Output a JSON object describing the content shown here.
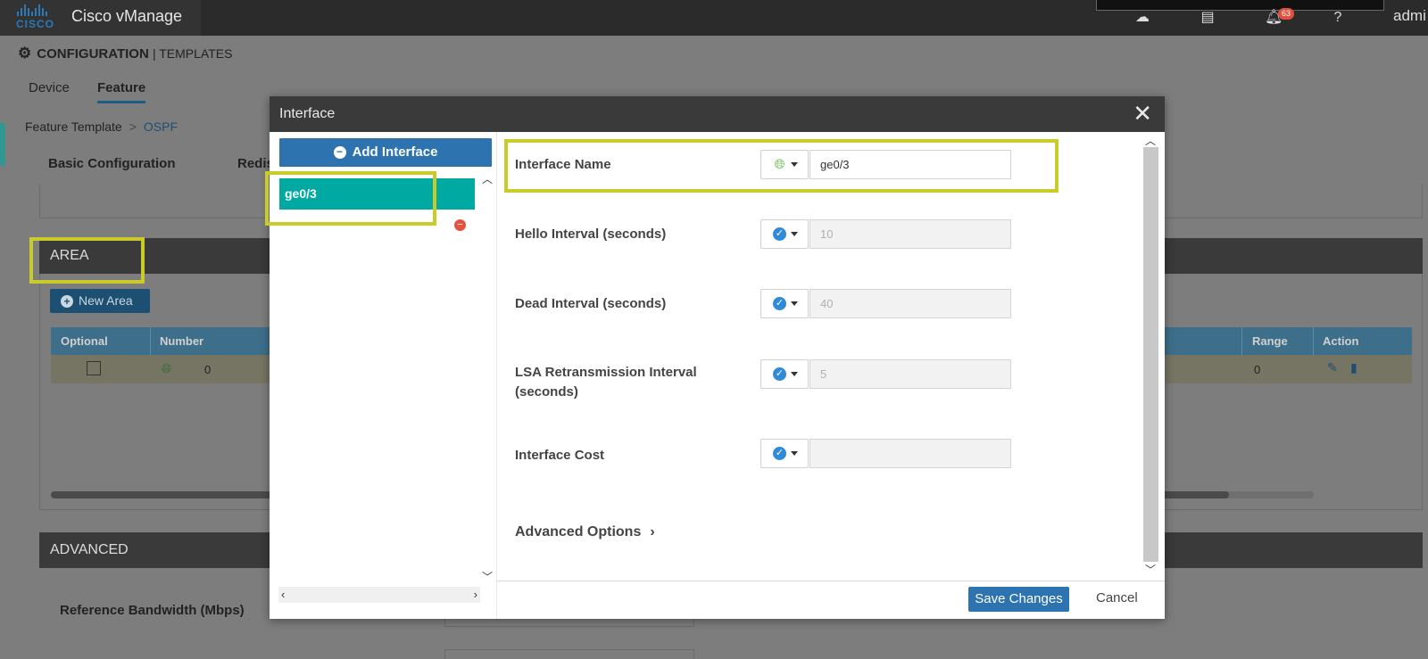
{
  "topbar": {
    "logo_word": "CISCO",
    "app_name": "Cisco vManage",
    "notification_count": "63",
    "user": "admi",
    "icons": [
      "cloud-icon",
      "clipboard-icon",
      "bell-icon",
      "help-icon"
    ]
  },
  "page": {
    "title": "CONFIGURATION",
    "title_separator": "|",
    "subtitle": "TEMPLATES",
    "tabs": [
      "Device",
      "Feature"
    ],
    "active_tab": "Feature",
    "breadcrumb": {
      "parent": "Feature Template",
      "separator": ">",
      "current": "OSPF"
    },
    "subtabs": [
      "Basic Configuration",
      "Redis"
    ]
  },
  "area": {
    "heading": "AREA",
    "new_button": "New Area",
    "columns": [
      "Optional",
      "Number",
      "Range",
      "Action"
    ],
    "row": {
      "number": "0",
      "range": "0"
    }
  },
  "advanced": {
    "heading": "ADVANCED",
    "reference_bandwidth_label": "Reference Bandwidth (Mbps)"
  },
  "modal": {
    "title": "Interface",
    "add_button": "Add Interface",
    "interfaces": [
      "ge0/3"
    ],
    "fields": [
      {
        "label": "Interface Name",
        "scope_icon": "globe-icon",
        "value": "ge0/3",
        "editable": true
      },
      {
        "label": "Hello Interval (seconds)",
        "scope_icon": "check-icon",
        "value": "10",
        "editable": false
      },
      {
        "label": "Dead Interval (seconds)",
        "scope_icon": "check-icon",
        "value": "40",
        "editable": false
      },
      {
        "label": "LSA Retransmission Interval (seconds)",
        "scope_icon": "check-icon",
        "value": "5",
        "editable": false
      },
      {
        "label": "Interface Cost",
        "scope_icon": "check-icon",
        "value": "",
        "editable": false
      }
    ],
    "advanced_options": "Advanced Options",
    "save_button": "Save Changes",
    "cancel_button": "Cancel"
  },
  "colors": {
    "highlight": "#c8cb2a",
    "primary_button": "#2c73b0",
    "selected_interface": "#00aaa2"
  }
}
